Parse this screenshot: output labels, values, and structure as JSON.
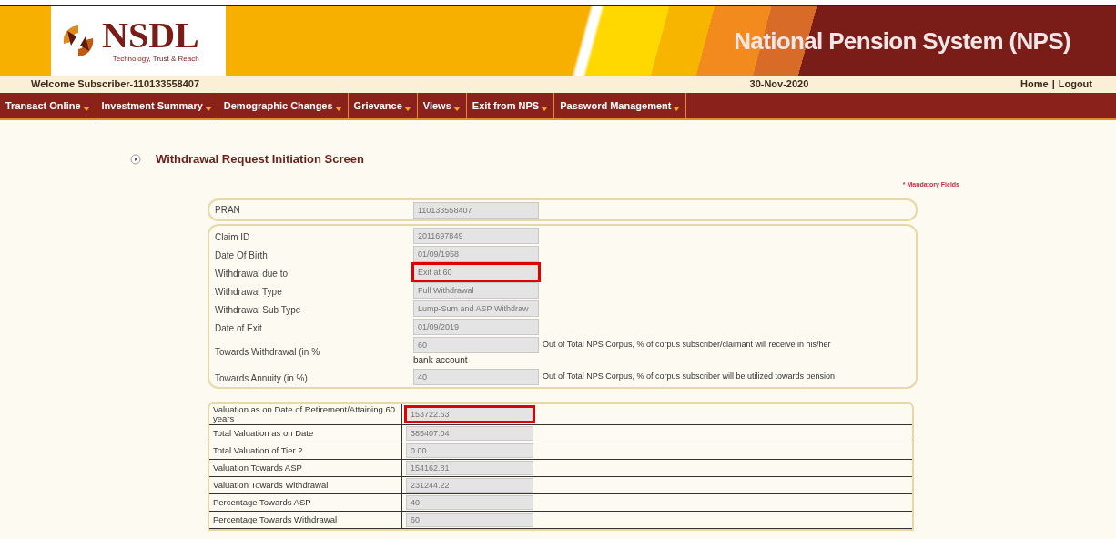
{
  "header": {
    "logo_text": "NSDL",
    "tagline": "Technology, Trust & Reach",
    "title": "National Pension System (NPS)",
    "welcome": "Welcome Subscriber-110133558407",
    "date": "30-Nov-2020",
    "links": [
      "Home",
      "|",
      "Logout"
    ]
  },
  "nav": [
    "Transact Online",
    "Investment Summary",
    "Demographic Changes",
    "Grievance",
    "Views",
    "Exit from NPS",
    "Password Management"
  ],
  "page_title": "Withdrawal Request Initiation Screen",
  "mandatory_note": "* Mandatory Fields",
  "pran": {
    "label": "PRAN",
    "value": "110133558407"
  },
  "claim_fields": [
    {
      "label": "Claim ID",
      "value": "2011697849",
      "highlighted": false
    },
    {
      "label": "Date Of Birth",
      "value": "01/09/1958",
      "highlighted": false
    },
    {
      "label": "Withdrawal due to",
      "value": "Exit at 60",
      "highlighted": true
    },
    {
      "label": "Withdrawal Type",
      "value": "Full Withdrawal",
      "highlighted": false
    },
    {
      "label": "Withdrawal Sub Type",
      "value": "Lump-Sum and ASP Withdraw",
      "highlighted": false
    },
    {
      "label": "Date of Exit",
      "value": "01/09/2019",
      "highlighted": false
    },
    {
      "label": "Towards Withdrawal (in %",
      "value": "60",
      "note": "Out of Total NPS Corpus, % of corpus subscriber/claimant will receive in his/her",
      "note_cont": "bank account",
      "highlighted": false
    },
    {
      "label": "Towards Annuity (in %)",
      "value": "40",
      "note": "Out of Total NPS Corpus, % of corpus subscriber will be utilized towards pension",
      "highlighted": false
    }
  ],
  "valuation_rows": [
    {
      "label": "Valuation as on Date of Retirement/Attaining 60 years",
      "value": "153722.63",
      "highlighted": true
    },
    {
      "label": "Total Valuation as on Date",
      "value": "385407.04",
      "highlighted": false
    },
    {
      "label": "Total Valuation of Tier 2",
      "value": "0.00",
      "highlighted": false
    },
    {
      "label": "Valuation Towards ASP",
      "value": "154162.81",
      "highlighted": false
    },
    {
      "label": "Valuation Towards Withdrawal",
      "value": "231244.22",
      "highlighted": false
    },
    {
      "label": "Percentage Towards ASP",
      "value": "40",
      "highlighted": false
    },
    {
      "label": "Percentage Towards Withdrawal",
      "value": "60",
      "highlighted": false
    }
  ]
}
